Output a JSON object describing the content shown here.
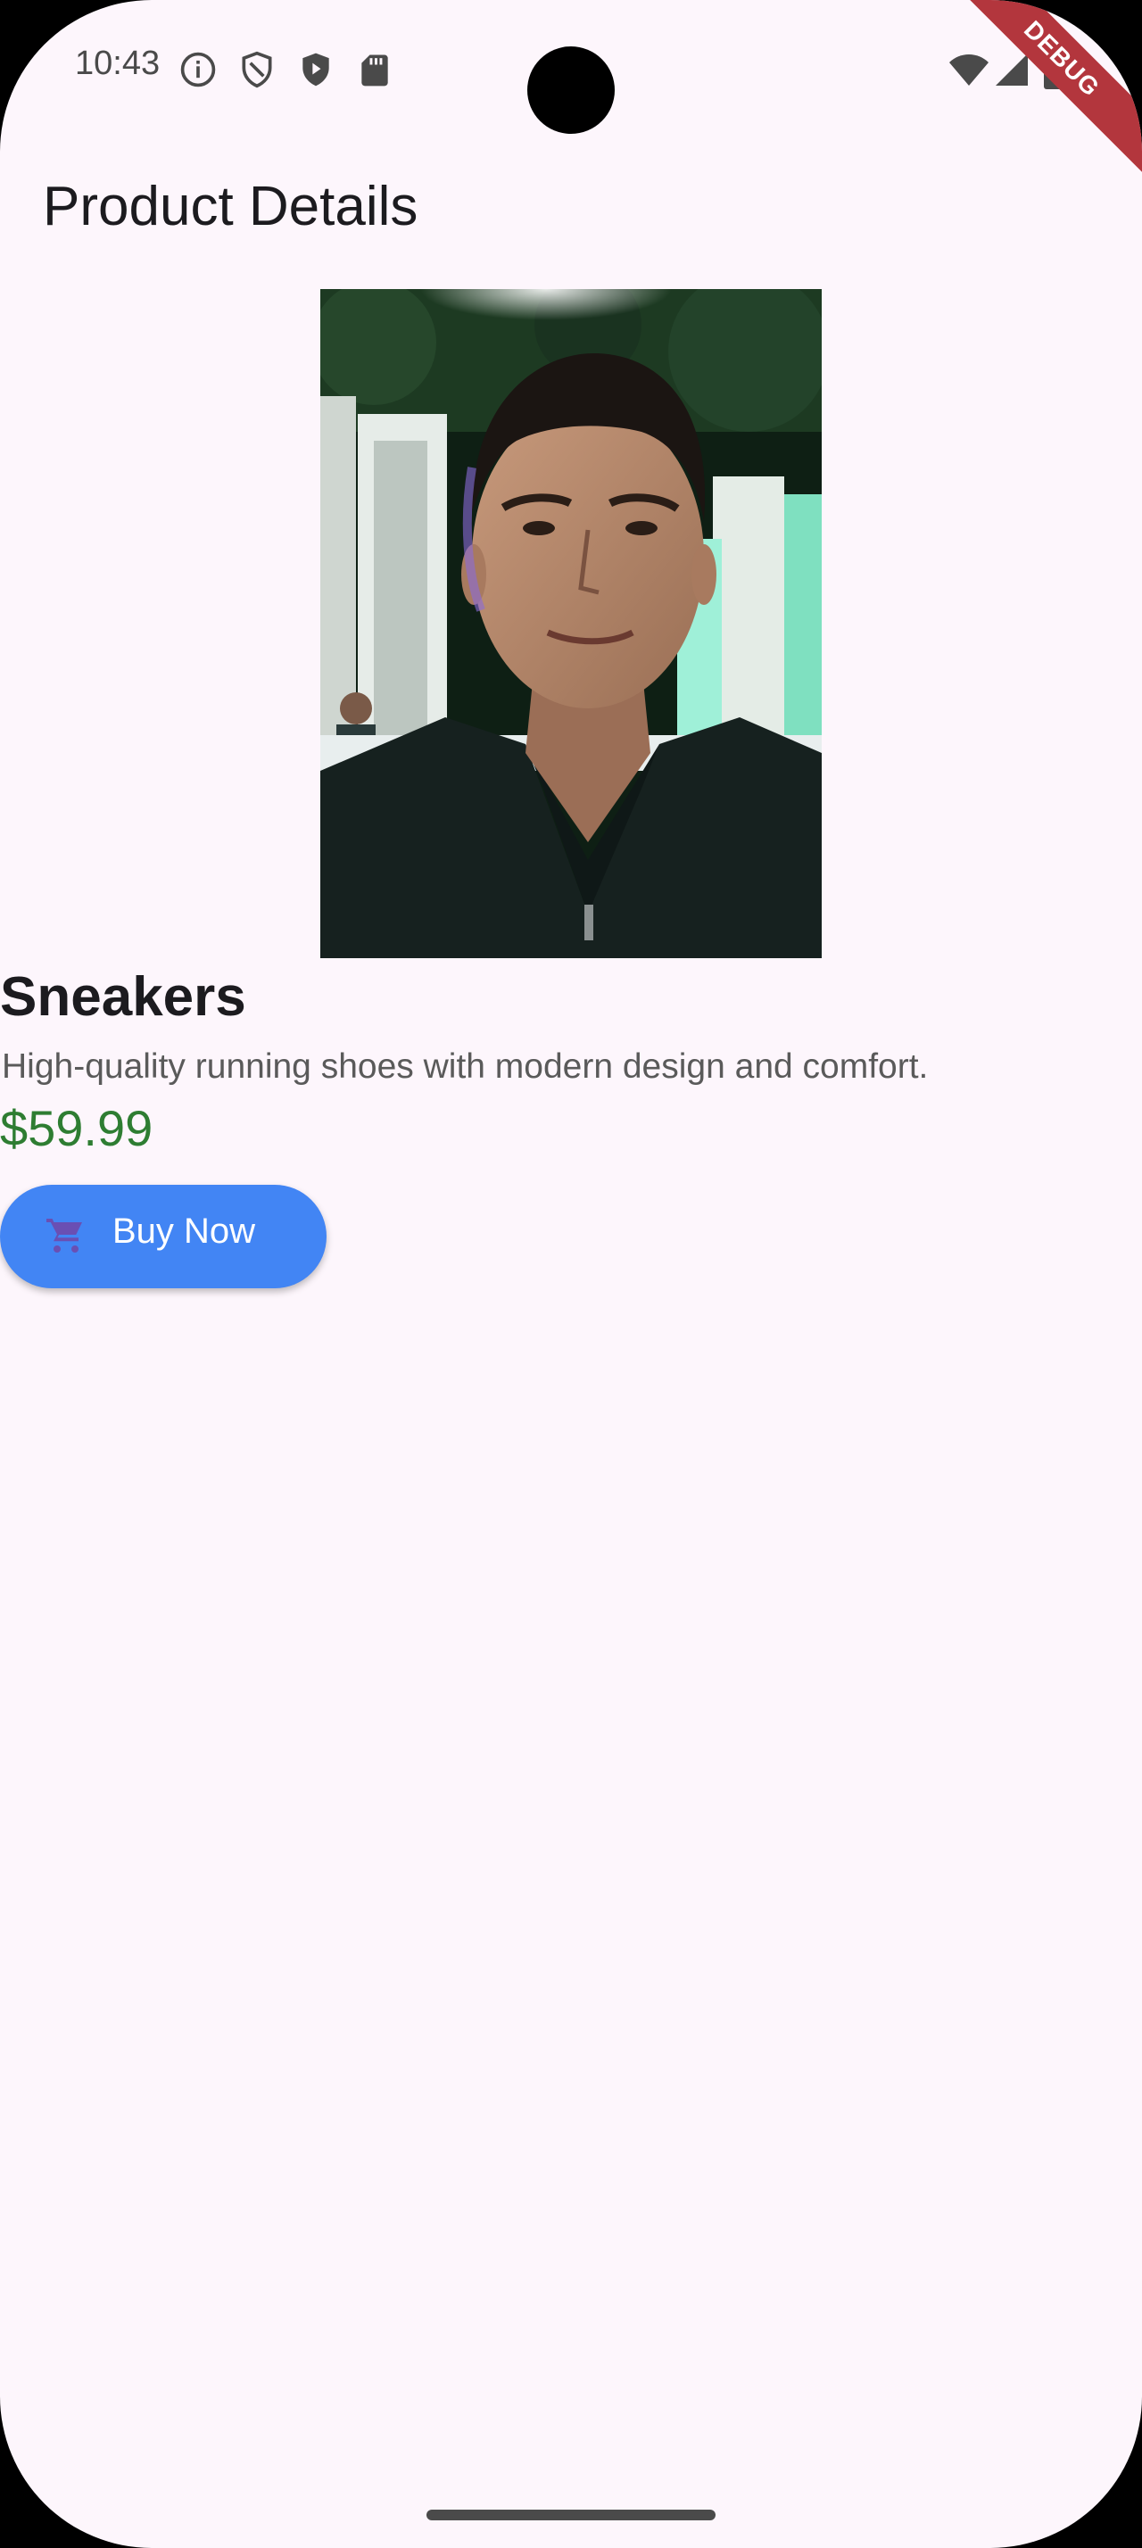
{
  "status_bar": {
    "time": "10:43",
    "icons_left": [
      "info-icon",
      "shield-outline-icon",
      "shield-play-icon",
      "sd-card-icon"
    ],
    "icons_right": [
      "wifi-icon",
      "cellular-signal-icon",
      "battery-icon"
    ],
    "debug_label": "DEBUG"
  },
  "app_bar": {
    "title": "Product Details"
  },
  "product": {
    "image_alt": "product photo",
    "name": "Sneakers",
    "description": "High-quality running shoes with modern design and comfort.",
    "price": "$59.99",
    "buy_label": "Buy Now",
    "buy_icon": "shopping-cart-icon"
  },
  "colors": {
    "background": "#fdf6fc",
    "price": "#2e7d32",
    "button": "#4285f4",
    "button_icon": "#6a4fb3",
    "debug_banner": "#b3363d"
  }
}
